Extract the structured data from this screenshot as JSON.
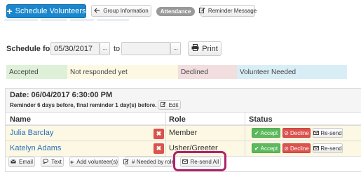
{
  "toolbar": {
    "schedule_volunteers": "Schedule Volunteers",
    "group_information": "Group Information",
    "attendance": "Attendance",
    "reminder_message": "Reminder Message"
  },
  "schedule": {
    "label": "Schedule for:",
    "from_date": "05/30/2017",
    "to_label": "to",
    "to_date": "",
    "picker_label": "...",
    "print": "Print"
  },
  "legend": [
    {
      "label": "Accepted",
      "color": "#dff0d8"
    },
    {
      "label": "Not responded yet",
      "color": "#fcf8e3"
    },
    {
      "label": "Declined",
      "color": "#f2dede"
    },
    {
      "label": "Volunteer Needed",
      "color": "#d9edf7"
    }
  ],
  "event": {
    "date": "Date: 06/04/2017 6:30:00 PM",
    "reminder": "Reminder 6 days before, final reminder 1 day(s) before.",
    "edit": "Edit"
  },
  "table": {
    "headers": [
      "Name",
      "Role",
      "Status"
    ],
    "rows": [
      {
        "name": "Julia Barclay",
        "role": "Member"
      },
      {
        "name": "Katelyn Adams",
        "role": "Usher/Greeter"
      }
    ],
    "remove_glyph": "✖",
    "accept": "Accept",
    "decline": "Decline",
    "resend": "Re-send"
  },
  "footer": {
    "email": "Email",
    "text": "Text",
    "add_volunteers": "Add volunteer(s)",
    "needed_by_role": "# Needed by role",
    "resend_all": "Re-send All"
  },
  "colors": {
    "primary": "#1a86cc",
    "link": "#2a6ebb",
    "accept": "#5cb85c",
    "decline": "#d9534f",
    "highlight": "#b0226a",
    "row_pending": "#fcf8e3"
  }
}
